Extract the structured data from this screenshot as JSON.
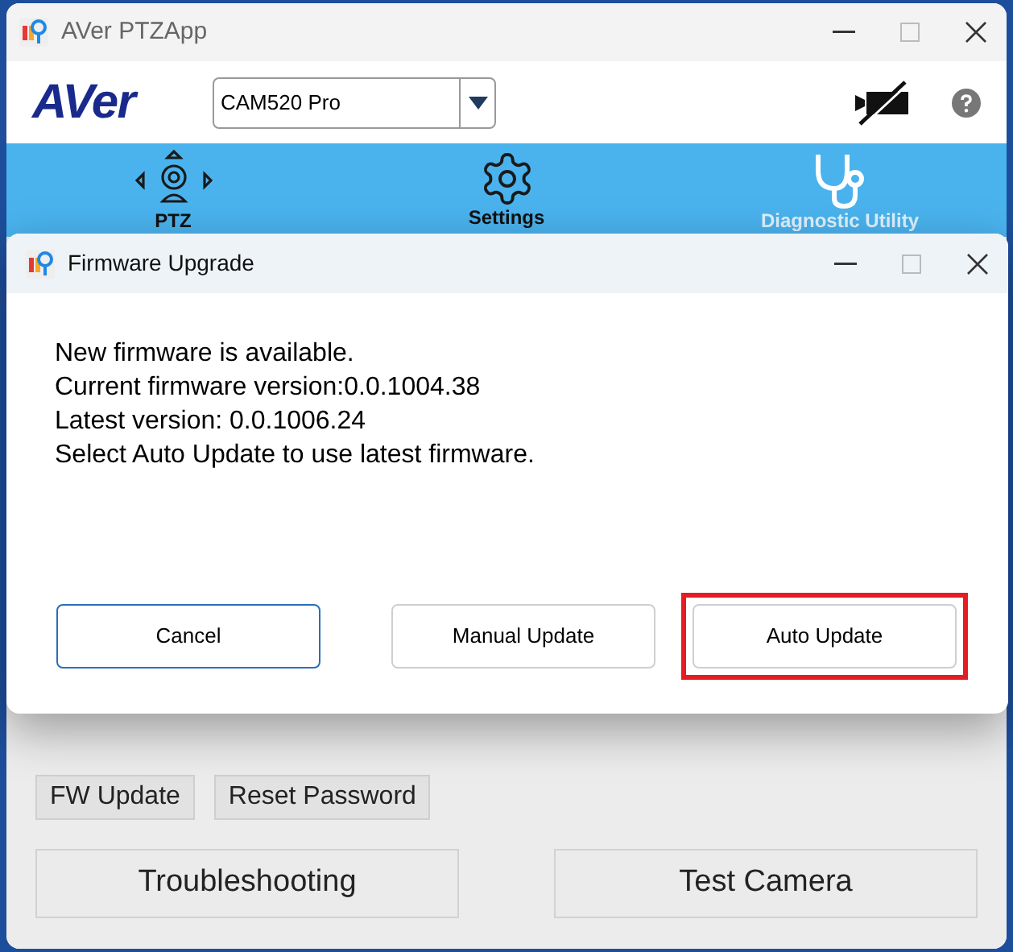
{
  "window": {
    "title": "AVer PTZApp"
  },
  "header": {
    "logo": "AVer",
    "camera_select": {
      "value": "CAM520 Pro"
    }
  },
  "nav_tabs": [
    {
      "label": "PTZ",
      "kind": "ptz",
      "selected": false
    },
    {
      "label": "Settings",
      "kind": "settings",
      "selected": false
    },
    {
      "label": "Diagnostic Utility",
      "kind": "diagnostic",
      "selected": true
    }
  ],
  "small_buttons": [
    "FW Update",
    "Reset Password"
  ],
  "large_buttons": [
    "Troubleshooting",
    "Test Camera"
  ],
  "dialog": {
    "title": "Firmware Upgrade",
    "message": [
      "New firmware is available.",
      "Current firmware version:0.0.1004.38",
      "Latest version: 0.0.1006.24",
      "Select Auto Update to use latest firmware."
    ],
    "buttons": [
      {
        "label": "Cancel",
        "focused": true,
        "highlighted": false
      },
      {
        "label": "Manual Update",
        "focused": false,
        "highlighted": false
      },
      {
        "label": "Auto Update",
        "focused": false,
        "highlighted": true
      }
    ]
  }
}
